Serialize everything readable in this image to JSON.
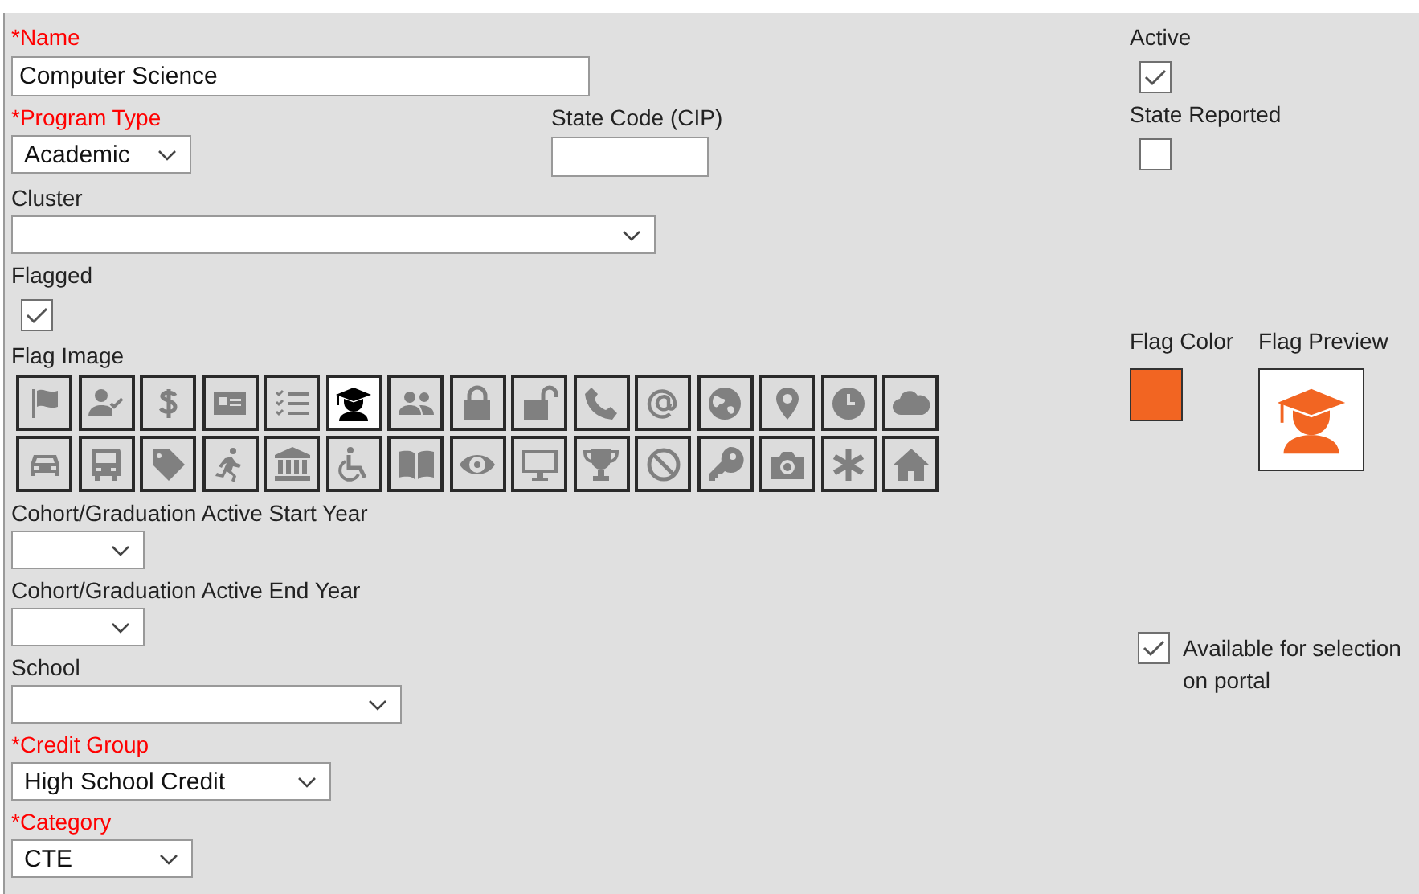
{
  "name": {
    "kind": "text",
    "label": "*Name",
    "required": true,
    "value": "Computer Science"
  },
  "active": {
    "kind": "checkbox",
    "label": "Active",
    "checked": true
  },
  "program_type": {
    "kind": "dropdown",
    "label": "*Program Type",
    "required": true,
    "value": "Academic"
  },
  "state_code": {
    "kind": "text",
    "label": "State Code (CIP)",
    "required": false
  },
  "state_reported": {
    "kind": "checkbox",
    "label": "State Reported",
    "checked": false
  },
  "cluster": {
    "kind": "dropdown",
    "label": "Cluster",
    "required": false
  },
  "flagged": {
    "kind": "checkbox",
    "label": "Flagged",
    "checked": true
  },
  "flag_image": {
    "label": "Flag Image",
    "options": [
      {
        "selected": false
      },
      {
        "selected": false
      },
      {
        "selected": false
      },
      {
        "selected": false
      },
      {
        "selected": false
      },
      {
        "selected": true
      },
      {
        "selected": false
      },
      {
        "selected": false
      },
      {
        "selected": false
      },
      {
        "selected": false
      },
      {
        "selected": false
      },
      {
        "selected": false
      },
      {
        "selected": false
      },
      {
        "selected": false
      },
      {
        "selected": false
      },
      {
        "selected": false
      },
      {
        "selected": false
      },
      {
        "selected": false
      },
      {
        "selected": false
      },
      {
        "selected": false
      },
      {
        "selected": false
      },
      {
        "selected": false
      },
      {
        "selected": false
      },
      {
        "selected": false
      },
      {
        "selected": false
      },
      {
        "selected": false
      },
      {
        "selected": false
      },
      {
        "selected": false
      },
      {
        "selected": false
      },
      {
        "selected": false
      }
    ]
  },
  "flag_color": {
    "label": "Flag Color",
    "color": "#f26522"
  },
  "flag_preview": {
    "label": "Flag Preview"
  },
  "cohort_start_year": {
    "kind": "dropdown",
    "label": "Cohort/Graduation Active Start Year",
    "required": false
  },
  "cohort_end_year": {
    "kind": "dropdown",
    "label": "Cohort/Graduation Active End Year",
    "required": false
  },
  "school": {
    "kind": "dropdown",
    "label": "School",
    "required": false
  },
  "available_on_portal": {
    "kind": "inline-checkbox",
    "label": "Available for selection on portal",
    "checked": true
  },
  "credit_group": {
    "kind": "dropdown",
    "label": "*Credit Group",
    "required": true,
    "value": "High School Credit"
  },
  "category": {
    "kind": "dropdown",
    "label": "*Category",
    "required": true,
    "value": "CTE"
  }
}
